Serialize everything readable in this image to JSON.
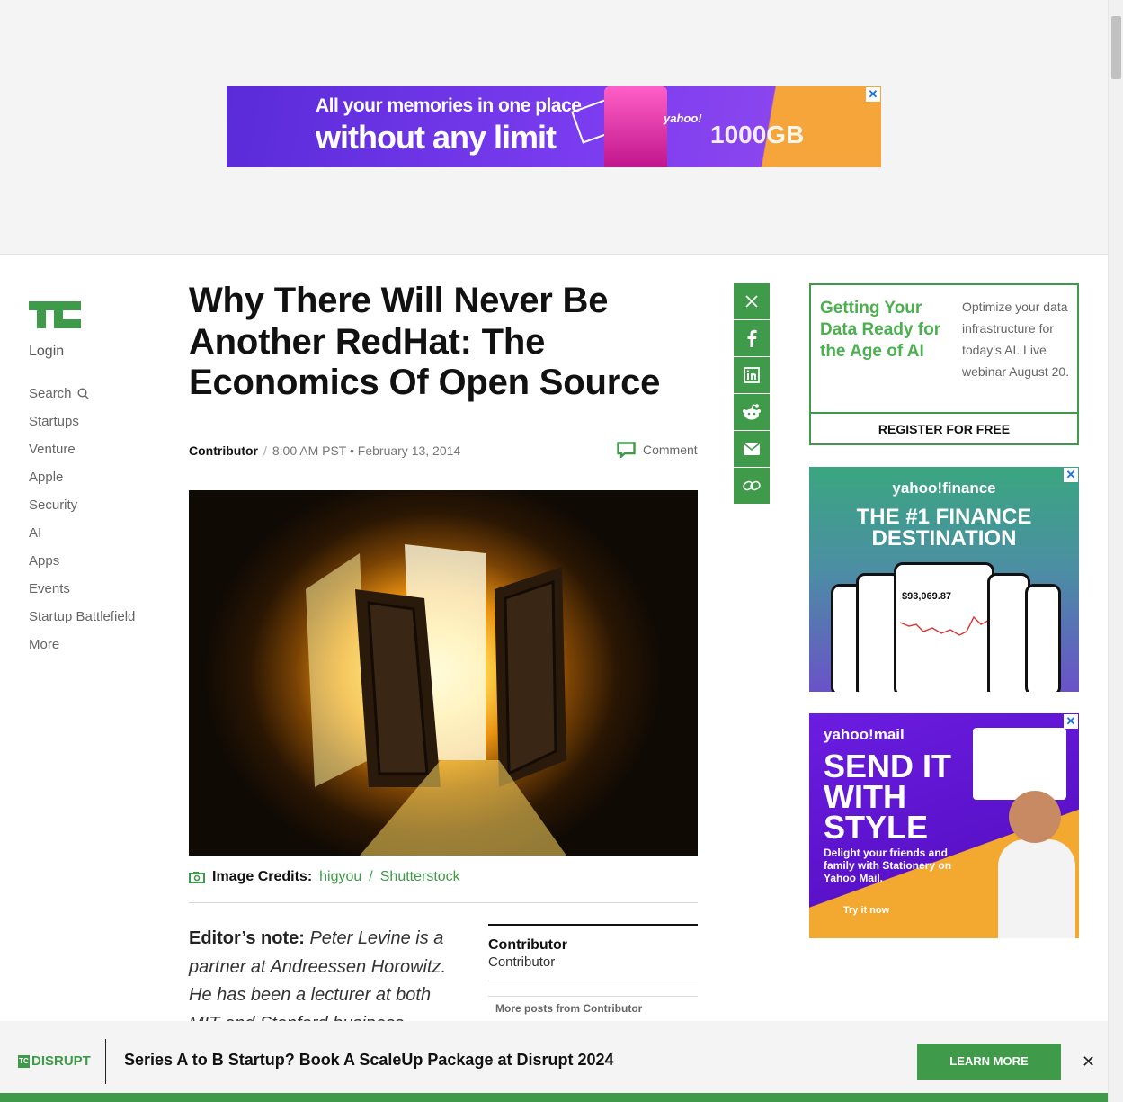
{
  "top_ad": {
    "line1": "All your memories in one place",
    "line2": "without any limit",
    "brand": "yahoo!",
    "capacity": "1000GB",
    "close": "✕"
  },
  "nav": {
    "login": "Login",
    "search": "Search",
    "items": [
      "Startups",
      "Venture",
      "Apple",
      "Security",
      "AI",
      "Apps",
      "Events",
      "Startup Battlefield",
      "More"
    ]
  },
  "article": {
    "title": "Why There Will Never Be Another RedHat: The Economics Of Open Source",
    "author": "Contributor",
    "separator": "/",
    "datetime": "8:00 AM PST • February 13, 2014",
    "comment_label": "Comment",
    "image_credits_label": "Image Credits:",
    "credit_1": "higyou",
    "credit_sep": "/",
    "credit_2": "Shutterstock",
    "editor_label": "Editor’s note:",
    "editor_text": "Peter Levine is a partner at Andreessen Horowitz. He has been a lecturer at both MIT and Stanford business"
  },
  "contributor_box": {
    "name": "Contributor",
    "role": "Contributor",
    "more": "More posts from Contributor"
  },
  "share": [
    "x-icon",
    "facebook-icon",
    "linkedin-icon",
    "reddit-icon",
    "email-icon",
    "link-icon"
  ],
  "webinar_ad": {
    "headline": "Getting Your Data Ready for the Age of AI",
    "description": "Optimize your data infrastructure for today's AI. Live webinar August 20.",
    "cta": "REGISTER FOR FREE"
  },
  "finance_ad": {
    "brand": "yahoo!finance",
    "headline_1": "THE #1 FINANCE",
    "headline_2": "DESTINATION",
    "value": "$93,069.87",
    "close": "✕"
  },
  "mail_ad": {
    "brand": "yahoo!mail",
    "headline": "SEND IT WITH STYLE",
    "sub": "Delight your friends and family with Stationery on Yahoo Mail.",
    "cta": "Try it now",
    "close": "✕"
  },
  "bottom_bar": {
    "logo_tc": "TC",
    "logo_text": "DISRUPT",
    "message": "Series A to B Startup? Book A ScaleUp Package at Disrupt 2024",
    "cta": "LEARN MORE",
    "close": "✕"
  },
  "colors": {
    "brand_green": "#3f9b49",
    "ad_purple": "#6b1de0",
    "ad_orange": "#f6a53a"
  }
}
